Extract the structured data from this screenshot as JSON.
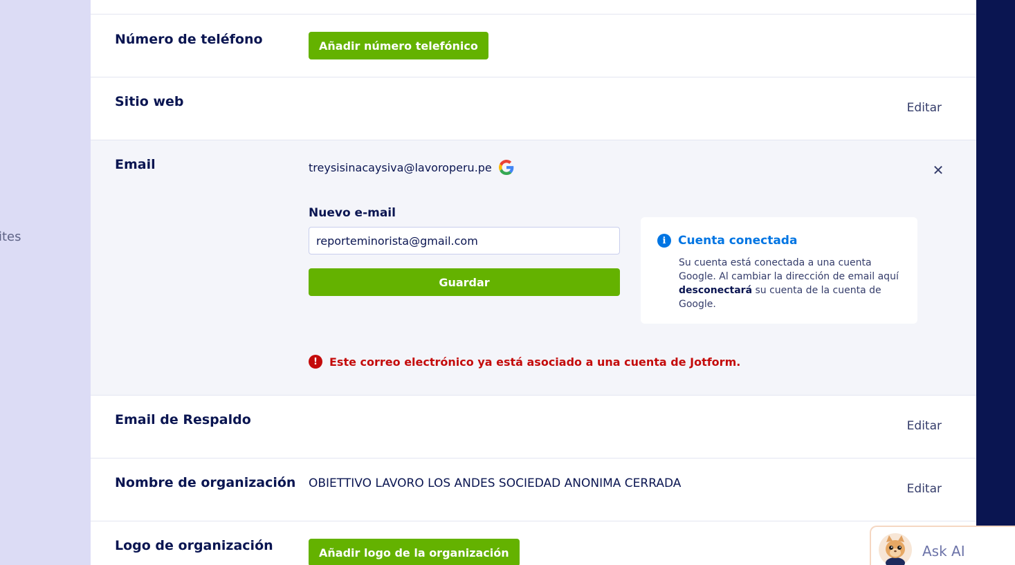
{
  "sidebar": {
    "nav_fragment": "ites"
  },
  "rows": {
    "phone": {
      "label": "Número de teléfono",
      "button": "Añadir número telefónico"
    },
    "website": {
      "label": "Sitio web",
      "edit": "Editar"
    },
    "email": {
      "label": "Email",
      "current_value": "treysisinacaysiva@lavoroperu.pe",
      "new_email_label": "Nuevo e-mail",
      "new_email_value": "reporteminorista@gmail.com",
      "save_button": "Guardar",
      "info_card": {
        "title": "Cuenta conectada",
        "text_before": "Su cuenta está conectada a una cuenta Google. Al cambiar la dirección de email aquí",
        "text_bold": "desconectará",
        "text_after": "su cuenta de la cuenta de Google."
      },
      "error": "Este correo electrónico ya está asociado a una cuenta de Jotform."
    },
    "backup_email": {
      "label": "Email de Respaldo",
      "edit": "Editar"
    },
    "org_name": {
      "label": "Nombre de organización",
      "value": "OBIETTIVO LAVORO LOS ANDES SOCIEDAD ANONIMA CERRADA",
      "edit": "Editar"
    },
    "org_logo": {
      "label": "Logo de organización",
      "button": "Añadir logo de la organización"
    }
  },
  "ask_ai": {
    "label": "Ask AI"
  },
  "icons": {
    "close": "close-icon",
    "google": "google-icon",
    "info": "info-icon",
    "error": "error-icon",
    "ask_ai_avatar": "ask-ai-avatar-icon"
  },
  "colors": {
    "primary_green": "#64b200",
    "navy": "#0a1551",
    "info_blue": "#0075e3",
    "error_red": "#c40b0b",
    "sidebar_lavender": "#dcdcf5"
  }
}
